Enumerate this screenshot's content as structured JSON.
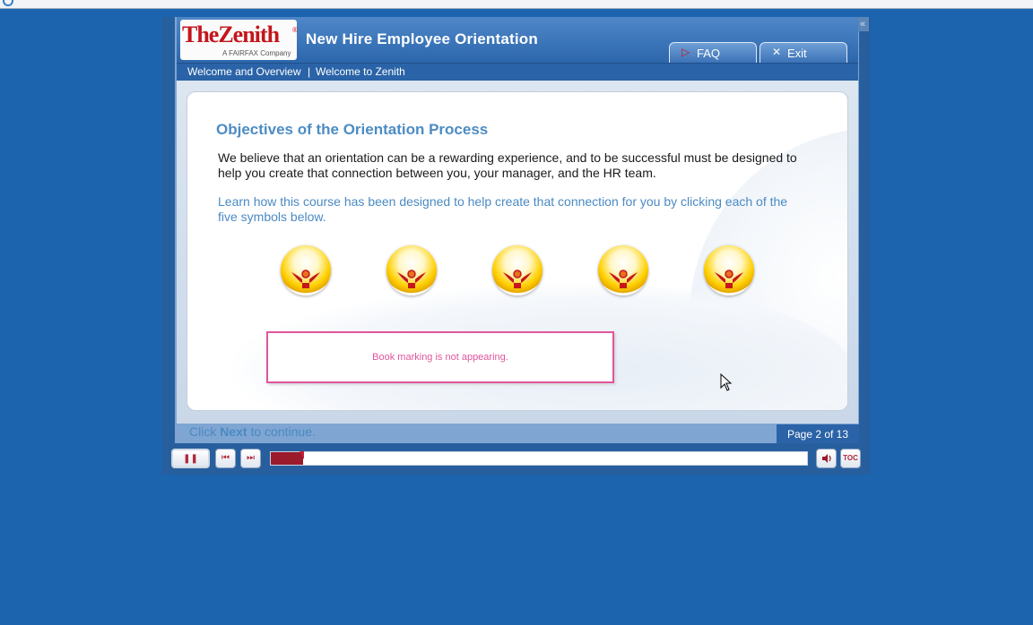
{
  "header": {
    "logo": "TheZenith",
    "logo_registered": "®",
    "logo_subtitle": "A FAIRFAX Company",
    "course_title": "New Hire Employee Orientation",
    "faq_label": "FAQ",
    "exit_label": "Exit",
    "collapse_glyph": "«"
  },
  "breadcrumb": {
    "section": "Welcome and Overview",
    "separator": "|",
    "page": "Welcome to Zenith"
  },
  "content": {
    "title": "Objectives of the Orientation Process",
    "paragraph1": "We believe that an orientation can be a rewarding experience, and to be successful must be designed to help you create that connection between you, your manager, and the HR team.",
    "paragraph2": "Learn how this course has been designed to help create that connection for you by clicking each of the five symbols below.",
    "symbols": [
      {
        "icon": "zenith-figure-icon"
      },
      {
        "icon": "zenith-figure-icon"
      },
      {
        "icon": "zenith-figure-icon"
      },
      {
        "icon": "zenith-figure-icon"
      },
      {
        "icon": "zenith-figure-icon"
      }
    ],
    "note": "Book marking is not appearing."
  },
  "footer": {
    "prefix": "Click ",
    "next_word": "Next",
    "suffix": " to continue.",
    "page_indicator": "Page 2 of 13"
  },
  "controls": {
    "pause_glyph": "❚❚",
    "prev_glyph": "⏮",
    "next_glyph": "⏭",
    "audio_glyph": "🔊",
    "toc_label": "TOC",
    "progress_fraction": 0.06
  },
  "colors": {
    "background": "#1d64ae",
    "accent_red": "#c4161c",
    "heading_blue": "#4d8cc3",
    "note_pink": "#e0559c"
  }
}
